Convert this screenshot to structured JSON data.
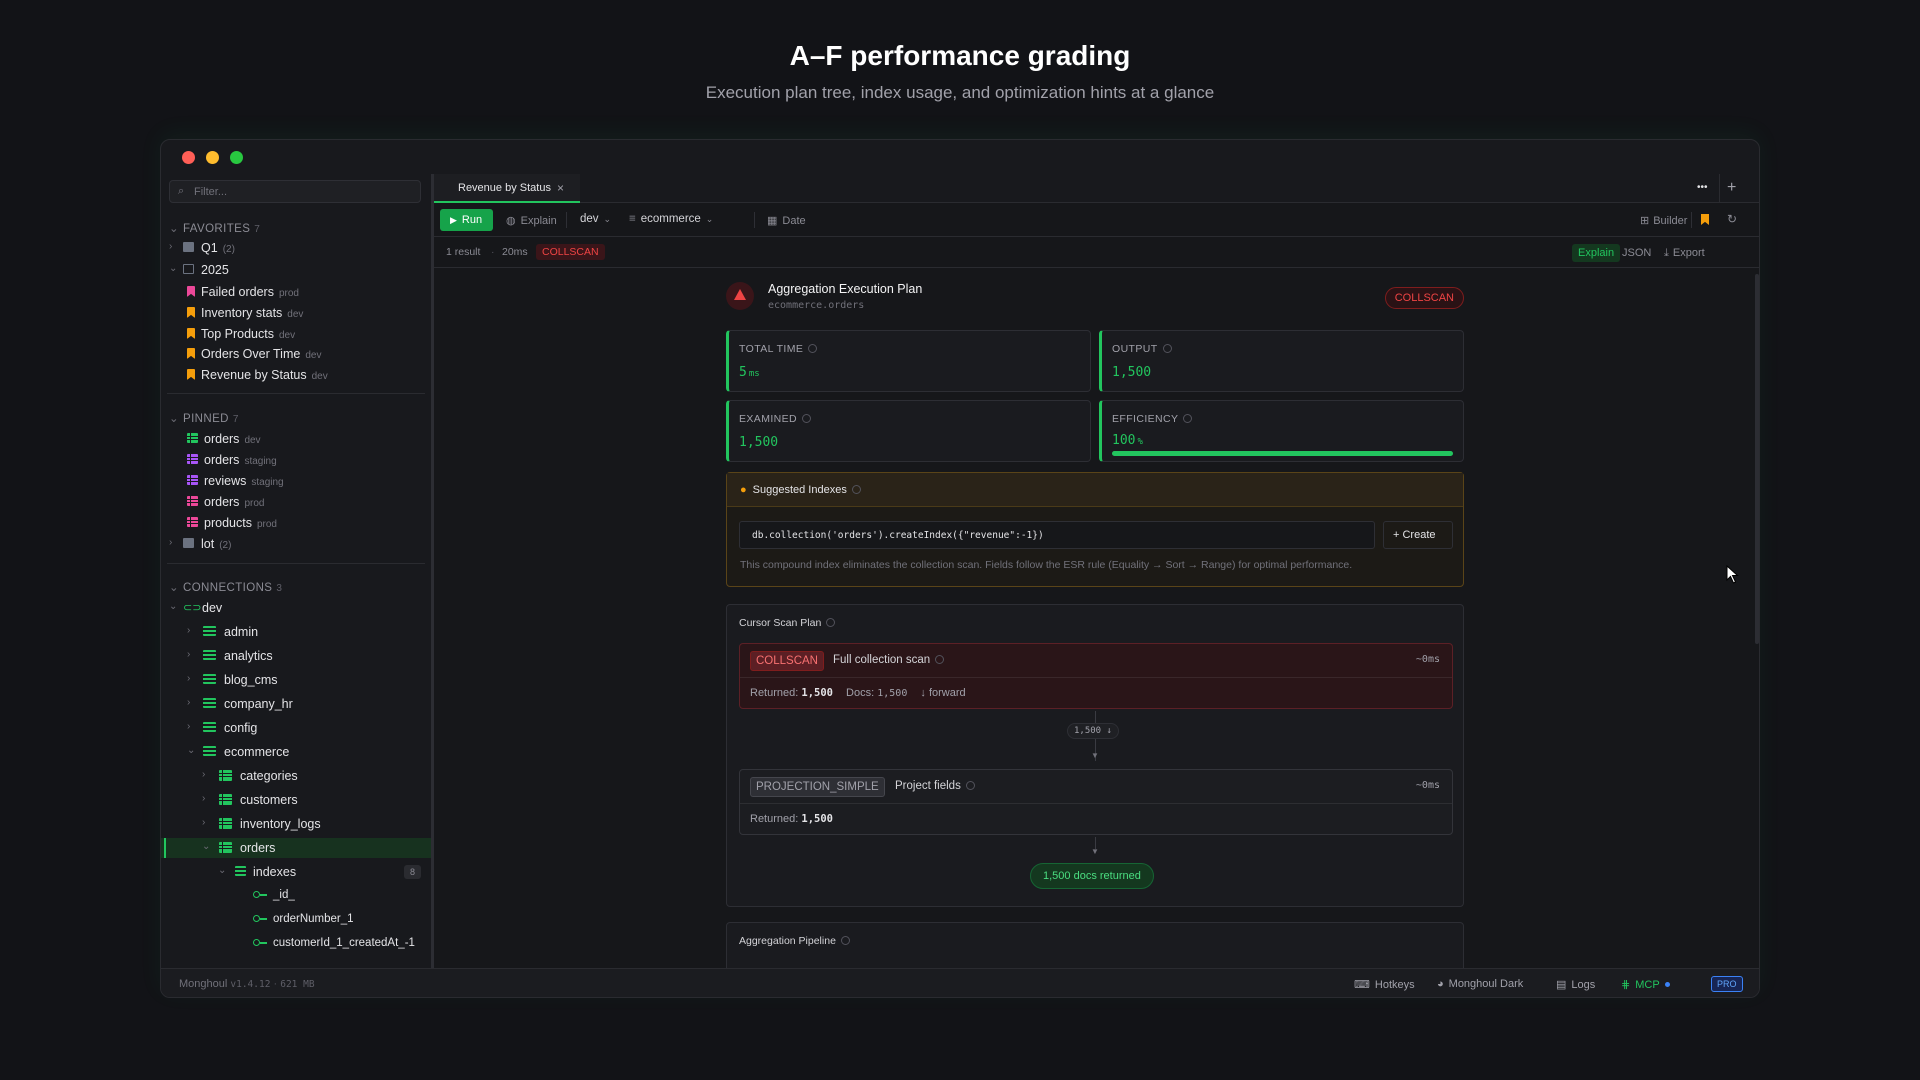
{
  "hero": {
    "title": "A–F performance grading",
    "subtitle": "Execution plan tree, index usage, and optimization hints at a glance"
  },
  "sidebar": {
    "filter_placeholder": "Filter...",
    "favorites": {
      "label": "FAVORITES",
      "count": "7",
      "folders": [
        {
          "name": "Q1",
          "count": "(2)"
        },
        {
          "name": "2025"
        }
      ],
      "items": [
        {
          "name": "Failed orders",
          "env": "prod"
        },
        {
          "name": "Inventory stats",
          "env": "dev"
        },
        {
          "name": "Top Products",
          "env": "dev"
        },
        {
          "name": "Orders Over Time",
          "env": "dev"
        },
        {
          "name": "Revenue by Status",
          "env": "dev"
        }
      ]
    },
    "pinned": {
      "label": "PINNED",
      "count": "7",
      "items": [
        {
          "name": "orders",
          "env": "dev"
        },
        {
          "name": "orders",
          "env": "staging"
        },
        {
          "name": "reviews",
          "env": "staging"
        },
        {
          "name": "orders",
          "env": "prod"
        },
        {
          "name": "products",
          "env": "prod"
        }
      ],
      "folder": {
        "name": "lot",
        "count": "(2)"
      }
    },
    "connections": {
      "label": "CONNECTIONS",
      "count": "3",
      "connection": "dev",
      "databases": [
        "admin",
        "analytics",
        "blog_cms",
        "company_hr",
        "config",
        "ecommerce"
      ],
      "collections": [
        "categories",
        "customers",
        "inventory_logs",
        "orders"
      ],
      "indexes_label": "indexes",
      "indexes_count": "8",
      "indexes": [
        "_id_",
        "orderNumber_1",
        "customerId_1_createdAt_-1"
      ]
    }
  },
  "tabs": [
    {
      "label": "Revenue by Status",
      "close": "×"
    }
  ],
  "toolbar": {
    "run": "Run",
    "explain": "Explain",
    "connection": "dev",
    "database": "ecommerce",
    "date": "Date",
    "builder": "Builder",
    "more": "•••",
    "add": "+"
  },
  "statusline": {
    "results": "1 result",
    "sep": "·",
    "time": "20ms",
    "badge": "COLLSCAN",
    "view_explain": "Explain",
    "view_json": "JSON",
    "export": "Export"
  },
  "plan": {
    "title": "Aggregation Execution Plan",
    "namespace": "ecommerce.orders",
    "badge": "COLLSCAN",
    "metrics": [
      {
        "label": "TOTAL TIME",
        "value": "5",
        "unit": "ms"
      },
      {
        "label": "OUTPUT",
        "value": "1,500"
      },
      {
        "label": "EXAMINED",
        "value": "1,500"
      },
      {
        "label": "EFFICIENCY",
        "value": "100",
        "unit": "%",
        "percent": 100
      }
    ],
    "suggested": {
      "title": "Suggested Indexes",
      "command": "db.collection('orders').createIndex({\"revenue\":-1})",
      "create": "+ Create",
      "note": "This compound index eliminates the collection scan. Fields follow the ESR rule (Equality → Sort → Range) for optimal performance."
    },
    "cursor": {
      "title": "Cursor Scan Plan",
      "stage1": {
        "tag": "COLLSCAN",
        "desc": "Full collection scan",
        "time": "~0ms",
        "returned_label": "Returned:",
        "returned": "1,500",
        "docs_label": "Docs:",
        "docs": "1,500",
        "direction": "↓ forward"
      },
      "connector": "1,500 ↓",
      "stage2": {
        "tag": "PROJECTION_SIMPLE",
        "desc": "Project fields",
        "time": "~0ms",
        "returned_label": "Returned:",
        "returned": "1,500"
      },
      "final": "1,500 docs returned"
    },
    "next_section": "Aggregation Pipeline"
  },
  "bottombar": {
    "app": "Monghoul",
    "version": "v1.4.12",
    "memory": "621 MB",
    "hotkeys": "Hotkeys",
    "theme": "Monghoul Dark",
    "logs": "Logs",
    "mcp": "MCP",
    "pro": "PRO"
  }
}
